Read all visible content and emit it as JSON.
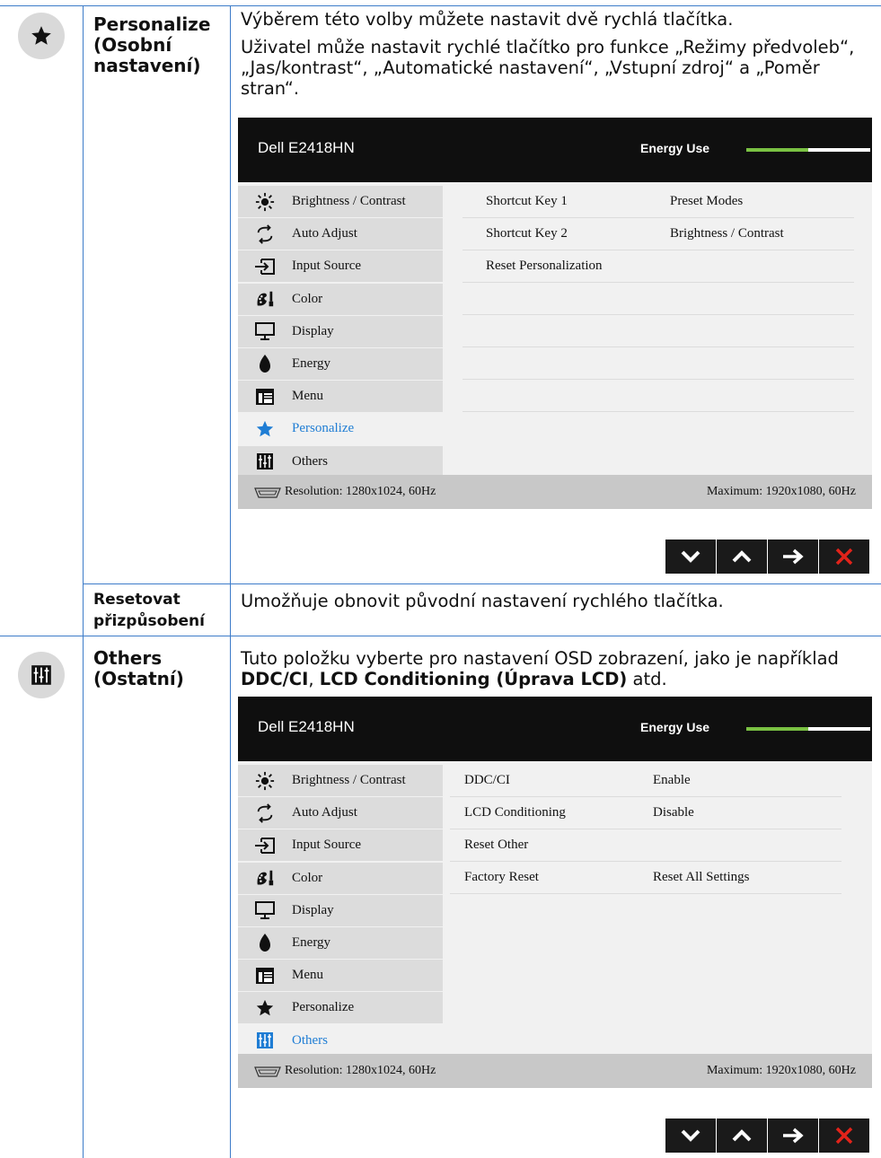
{
  "sections": [
    {
      "icon": "star-icon",
      "label": "Personalize (Osobní nastavení)",
      "desc_p1": "Výběrem této volby můžete nastavit dvě rychlá tlačítka.",
      "desc_p2": "Uživatel může nastavit rychlé tlačítko pro funkce „Režimy předvoleb“, „Jas/kontrast“, „Automatické nastavení“, „Vstupní zdroj“ a „Poměr stran“."
    },
    {
      "label": "Resetovat přizpůsobení",
      "desc": "Umožňuje obnovit původní nastavení rychlého tlačítka."
    },
    {
      "icon": "others-icon",
      "label": "Others (Ostatní)",
      "desc_prefix": "Tuto položku vyberte pro nastavení OSD zobrazení, jako je například ",
      "desc_bold1": "DDC/CI",
      "desc_mid": ", ",
      "desc_bold2": "LCD Conditioning (Úprava LCD)",
      "desc_suffix": " atd."
    }
  ],
  "osd": {
    "model": "Dell E2418HN",
    "energy_label": "Energy Use",
    "energy_level": 0.5,
    "menu": [
      "Brightness / Contrast",
      "Auto Adjust",
      "Input Source",
      "Color",
      "Display",
      "Energy",
      "Menu",
      "Personalize",
      "Others"
    ],
    "resolution": "Resolution: 1280x1024, 60Hz",
    "maximum": "Maximum: 1920x1080, 60Hz"
  },
  "osd1_options": [
    {
      "name": "Shortcut Key 1",
      "value": "Preset Modes"
    },
    {
      "name": "Shortcut Key 2",
      "value": "Brightness / Contrast"
    },
    {
      "name": "Reset Personalization",
      "value": ""
    }
  ],
  "osd2_options": [
    {
      "name": "DDC/CI",
      "value": "Enable"
    },
    {
      "name": "LCD Conditioning",
      "value": "Disable"
    },
    {
      "name": "Reset Other",
      "value": ""
    },
    {
      "name": "Factory Reset",
      "value": "Reset All Settings"
    }
  ],
  "colors": {
    "rule": "#3d7cc9",
    "accent": "#1f7dd4",
    "energy_green": "#7ac143",
    "close_red": "#e2231a"
  }
}
